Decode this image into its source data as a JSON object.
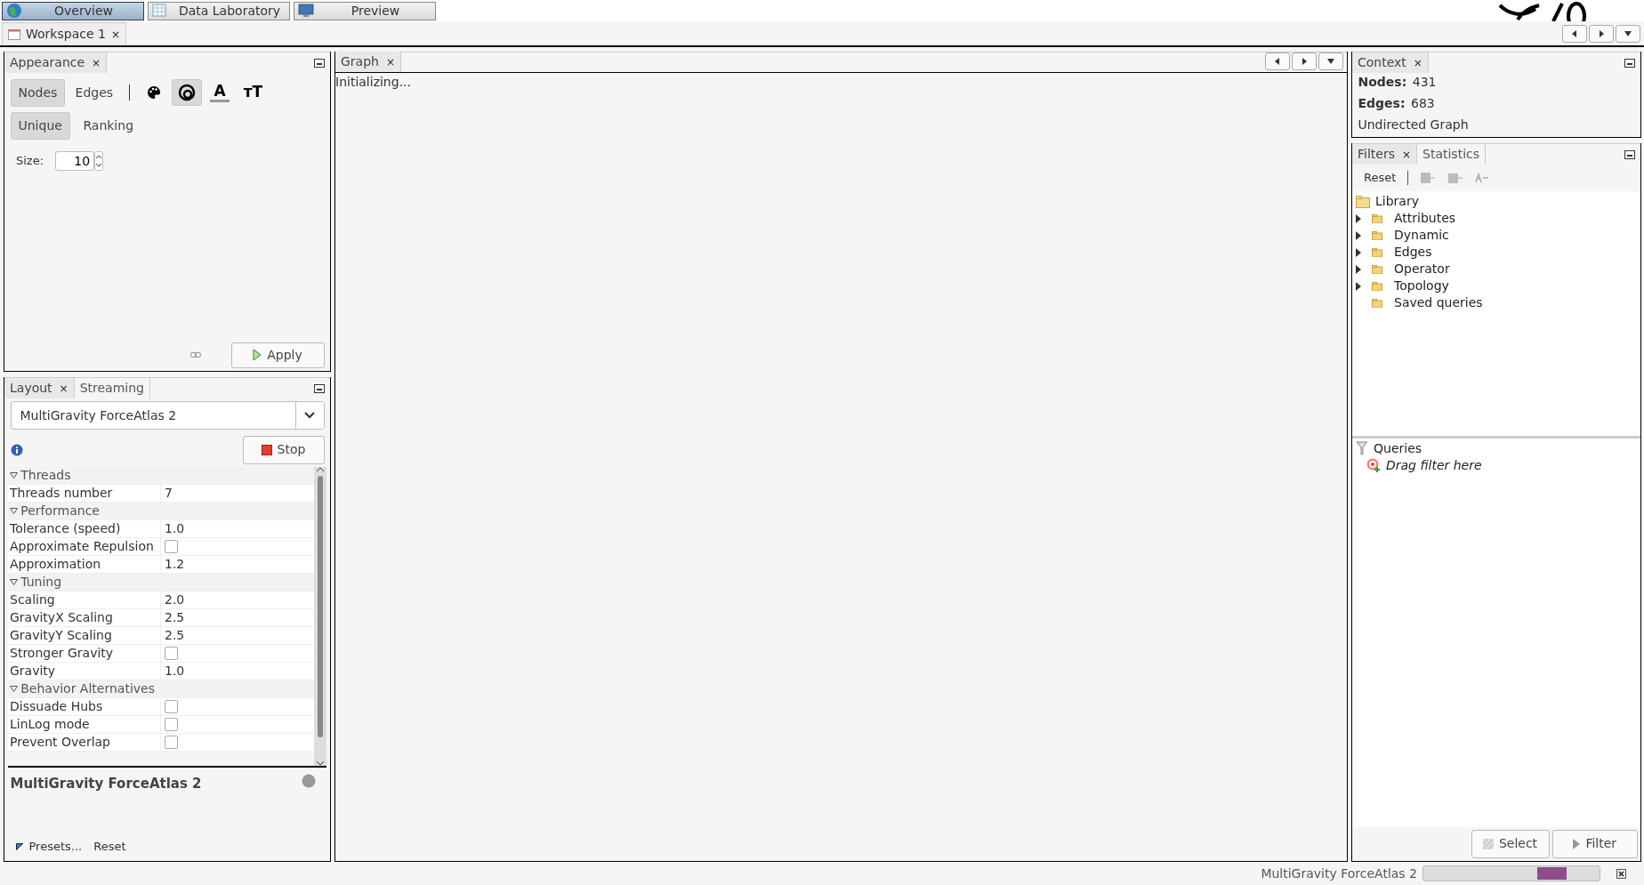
{
  "perspectives": [
    {
      "label": "Overview",
      "selected": true
    },
    {
      "label": "Data Laboratory",
      "selected": false
    },
    {
      "label": "Preview",
      "selected": false
    }
  ],
  "workspace_tabs": [
    {
      "label": "Workspace 1",
      "close": "×",
      "selected": true
    }
  ],
  "appearance": {
    "tabs": [
      {
        "label": "Appearance",
        "close": "×",
        "selected": true
      }
    ],
    "element_tabs": [
      {
        "label": "Nodes",
        "selected": true
      },
      {
        "label": "Edges",
        "selected": false
      }
    ],
    "transform_buttons": [
      {
        "kind": "palette",
        "selected": false
      },
      {
        "kind": "size",
        "selected": true
      },
      {
        "kind": "label-color",
        "label": "A",
        "selected": false
      },
      {
        "kind": "label-size",
        "label": "ᴛT",
        "selected": false
      }
    ],
    "mode_tabs": [
      {
        "label": "Unique",
        "selected": true
      },
      {
        "label": "Ranking",
        "selected": false
      }
    ],
    "size_label": "Size:",
    "size_value": "10",
    "apply": "Apply"
  },
  "layout": {
    "tabs": [
      {
        "label": "Layout",
        "close": "×",
        "selected": true
      },
      {
        "label": "Streaming",
        "selected": false
      }
    ],
    "algorithm": "MultiGravity ForceAtlas 2",
    "stop": "Stop",
    "properties": [
      {
        "kind": "category",
        "label": "Threads"
      },
      {
        "kind": "value",
        "label": "Threads number",
        "value": "7"
      },
      {
        "kind": "category",
        "label": "Performance"
      },
      {
        "kind": "value",
        "label": "Tolerance (speed)",
        "value": "1.0"
      },
      {
        "kind": "checkbox",
        "label": "Approximate Repulsion",
        "checked": false
      },
      {
        "kind": "value",
        "label": "Approximation",
        "value": "1.2"
      },
      {
        "kind": "category",
        "label": "Tuning"
      },
      {
        "kind": "value",
        "label": "Scaling",
        "value": "2.0"
      },
      {
        "kind": "value",
        "label": "GravityX Scaling",
        "value": "2.5"
      },
      {
        "kind": "value",
        "label": "GravityY Scaling",
        "value": "2.5"
      },
      {
        "kind": "checkbox",
        "label": "Stronger Gravity",
        "checked": false
      },
      {
        "kind": "value",
        "label": "Gravity",
        "value": "1.0"
      },
      {
        "kind": "category",
        "label": "Behavior Alternatives"
      },
      {
        "kind": "checkbox",
        "label": "Dissuade Hubs",
        "checked": false
      },
      {
        "kind": "checkbox",
        "label": "LinLog mode",
        "checked": false
      },
      {
        "kind": "checkbox",
        "label": "Prevent Overlap",
        "checked": false
      }
    ],
    "description_title": "MultiGravity ForceAtlas 2",
    "presets": "Presets...",
    "reset": "Reset"
  },
  "graph": {
    "tabs": [
      {
        "label": "Graph",
        "close": "×",
        "selected": true
      }
    ],
    "status": "Initializing..."
  },
  "context": {
    "tabs": [
      {
        "label": "Context",
        "close": "×",
        "selected": true
      }
    ],
    "nodes_label": "Nodes:",
    "nodes": "431",
    "edges_label": "Edges:",
    "edges": "683",
    "graph_type": "Undirected Graph"
  },
  "filters": {
    "tabs": [
      {
        "label": "Filters",
        "close": "×",
        "selected": true
      },
      {
        "label": "Statistics",
        "selected": false
      }
    ],
    "reset": "Reset",
    "library": {
      "label": "Library",
      "children": [
        {
          "label": "Attributes",
          "expandable": true
        },
        {
          "label": "Dynamic",
          "expandable": true
        },
        {
          "label": "Edges",
          "expandable": true
        },
        {
          "label": "Operator",
          "expandable": true
        },
        {
          "label": "Topology",
          "expandable": true
        },
        {
          "label": "Saved queries",
          "expandable": false
        }
      ]
    },
    "queries_label": "Queries",
    "drop_hint": "Drag filter here",
    "select": "Select",
    "filter": "Filter"
  },
  "status_bar": {
    "task": "MultiGravity ForceAtlas 2"
  }
}
